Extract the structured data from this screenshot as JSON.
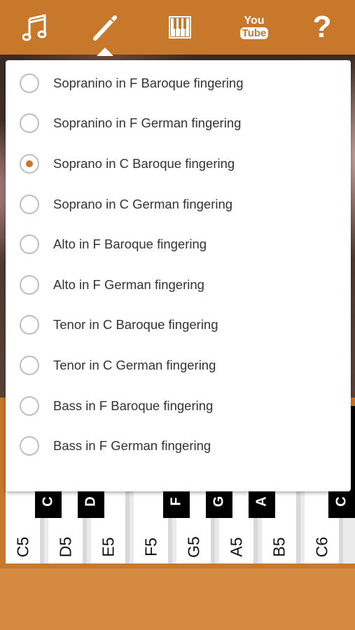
{
  "toolbar": {
    "icons": [
      "music-note-icon",
      "recorder-flute-icon",
      "piano-keys-icon",
      "youtube-icon",
      "help-icon"
    ],
    "youtube_top": "You",
    "youtube_bottom": "Tube",
    "help_label": "?"
  },
  "popup": {
    "options": [
      {
        "label": "Sopranino in F Baroque fingering",
        "selected": false
      },
      {
        "label": "Sopranino in F German fingering",
        "selected": false
      },
      {
        "label": "Soprano in C Baroque fingering",
        "selected": true
      },
      {
        "label": "Soprano in C German fingering",
        "selected": false
      },
      {
        "label": "Alto in F Baroque fingering",
        "selected": false
      },
      {
        "label": "Alto in F German fingering",
        "selected": false
      },
      {
        "label": "Tenor in C Baroque fingering",
        "selected": false
      },
      {
        "label": "Tenor in C German fingering",
        "selected": false
      },
      {
        "label": "Bass in F Baroque fingering",
        "selected": false
      },
      {
        "label": "Bass in F German fingering",
        "selected": false
      }
    ]
  },
  "keyboard": {
    "white_keys": [
      "C5",
      "D5",
      "E5",
      "F5",
      "G5",
      "A5",
      "B5",
      "C6"
    ],
    "black_keys": [
      "C",
      "D",
      "F",
      "G",
      "A",
      "C"
    ]
  },
  "colors": {
    "toolbar": "#c7782b",
    "accent": "#c7782b",
    "bottom": "#d58a42"
  }
}
